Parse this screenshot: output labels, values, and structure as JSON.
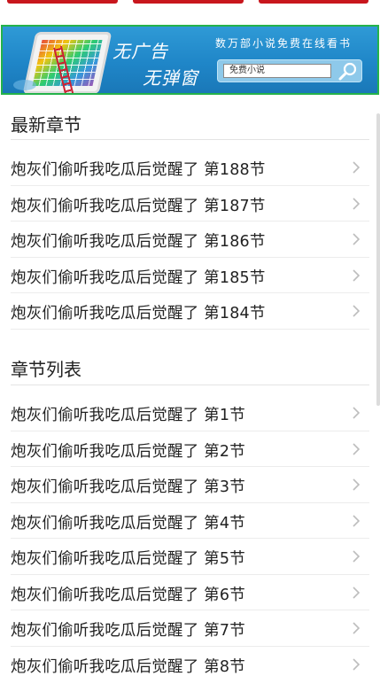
{
  "banner": {
    "line1": "无广告",
    "line2": "无弹窗",
    "slogan": "数万部小说免费在线看书",
    "search_value": "免费小说"
  },
  "latest": {
    "title": "最新章节",
    "items": [
      {
        "label": "炮灰们偷听我吃瓜后觉醒了 第188节"
      },
      {
        "label": "炮灰们偷听我吃瓜后觉醒了 第187节"
      },
      {
        "label": "炮灰们偷听我吃瓜后觉醒了 第186节"
      },
      {
        "label": "炮灰们偷听我吃瓜后觉醒了 第185节"
      },
      {
        "label": "炮灰们偷听我吃瓜后觉醒了 第184节"
      }
    ]
  },
  "chapters": {
    "title": "章节列表",
    "items": [
      {
        "label": "炮灰们偷听我吃瓜后觉醒了 第1节"
      },
      {
        "label": "炮灰们偷听我吃瓜后觉醒了 第2节"
      },
      {
        "label": "炮灰们偷听我吃瓜后觉醒了 第3节"
      },
      {
        "label": "炮灰们偷听我吃瓜后觉醒了 第4节"
      },
      {
        "label": "炮灰们偷听我吃瓜后觉醒了 第5节"
      },
      {
        "label": "炮灰们偷听我吃瓜后觉醒了 第6节"
      },
      {
        "label": "炮灰们偷听我吃瓜后觉醒了 第7节"
      },
      {
        "label": "炮灰们偷听我吃瓜后觉醒了 第8节"
      }
    ]
  },
  "colors": {
    "accent_red": "#c8161d",
    "banner_blue": "#1f86c8",
    "banner_border": "#24b24a"
  },
  "icons": {
    "chevron": "chevron-right-icon",
    "search": "search-icon"
  }
}
